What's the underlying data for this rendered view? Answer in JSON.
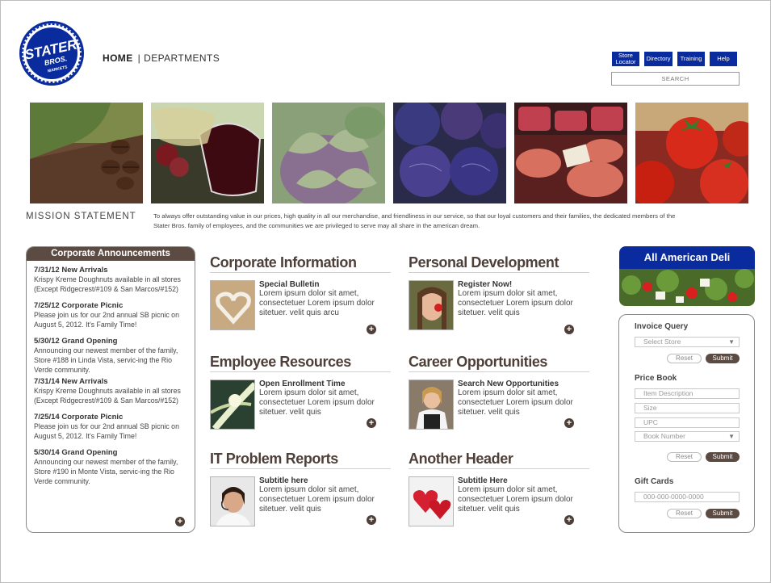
{
  "brand": {
    "logo_text": "STATER BROS. MARKETS"
  },
  "nav": {
    "home": "HOME",
    "separator": "|",
    "departments": "DEPARTMENTS"
  },
  "utility_buttons": [
    {
      "label": "Store Locator"
    },
    {
      "label": "Directory"
    },
    {
      "label": "Training"
    },
    {
      "label": "Help"
    }
  ],
  "search": {
    "placeholder": "SEARCH"
  },
  "mission": {
    "title": "MISSION STATEMENT",
    "text": "To always offer outstanding value in our prices, high quality in all our merchandise, and friendliness in our service, so that our loyal customers and their families, the dedicated members of the Stater Bros. family of employees, and the communities we are privileged to serve may all share in the american dream."
  },
  "announcements": {
    "title": "Corporate Announcements",
    "items": [
      {
        "date": "7/31/12 New Arrivals",
        "body": "Krispy Kreme Doughnuts available in all stores (Except Ridgecrest/#109 & San Marcos/#152)"
      },
      {
        "date": "7/25/12 Corporate Picnic",
        "body": "Please join us for our 2nd annual SB picnic on August 5, 2012.  It's Family Time!"
      },
      {
        "date": "5/30/12 Grand Opening",
        "body": "Announcing our newest member of the family, Store #188 in Linda Vista, servic-ing the Rio Verde community."
      },
      {
        "date": "7/31/14 New Arrivals",
        "body": "Krispy Kreme Doughnuts available in all stores (Except Ridgecrest/#109 & San Marcos/#152)"
      },
      {
        "date": "7/25/14 Corporate Picnic",
        "body": "Please join us for our 2nd annual SB picnic on August 5, 2012.  It's Family Time!"
      },
      {
        "date": "5/30/14 Grand Opening",
        "body": "Announcing our newest member of the family, Store #190 in Monte Vista, servic-ing the Rio Verde community."
      }
    ]
  },
  "sections": {
    "corporate": {
      "title": "Corporate Information",
      "subtitle": "Special Bulletin",
      "body": "Lorem ipsum dolor sit amet, consectetuer Lorem ipsum dolor sitetuer. velit quis arcu"
    },
    "personal": {
      "title": "Personal Development",
      "subtitle": "Register Now!",
      "body": "Lorem ipsum dolor sit amet, consectetuer Lorem ipsum dolor sitetuer. velit quis"
    },
    "employee": {
      "title": "Employee Resources",
      "subtitle": "Open Enrollment Time",
      "body": "Lorem ipsum dolor sit amet, consectetuer Lorem ipsum dolor sitetuer. velit quis"
    },
    "career": {
      "title": "Career Opportunities",
      "subtitle": "Search New Opportunities",
      "body": "Lorem ipsum dolor sit amet, consectetuer Lorem ipsum dolor sitetuer. velit quis"
    },
    "it": {
      "title": "IT Problem Reports",
      "subtitle": "Subtitle here",
      "body": "Lorem ipsum dolor sit amet, consectetuer Lorem ipsum dolor sitetuer. velit quis"
    },
    "another": {
      "title": "Another Header",
      "subtitle": "Subtitle Here",
      "body": "Lorem ipsum dolor sit amet, consectetuer Lorem ipsum dolor sitetuer. velit quis"
    }
  },
  "deli": {
    "title": "All American Deli"
  },
  "invoice": {
    "title": "Invoice Query",
    "select_placeholder": "Select Store",
    "reset": "Reset",
    "submit": "Submit"
  },
  "pricebook": {
    "title": "Price Book",
    "fields": [
      "Item Description",
      "Size",
      "UPC",
      "Book Number"
    ],
    "reset": "Reset",
    "submit": "Submit"
  },
  "giftcards": {
    "title": "Gift Cards",
    "placeholder": "000-000-0000-0000",
    "reset": "Reset",
    "submit": "Submit"
  },
  "colors": {
    "brand_blue": "#0a2b9e",
    "brown": "#5c4b42",
    "heading_brown": "#4e3f38"
  }
}
